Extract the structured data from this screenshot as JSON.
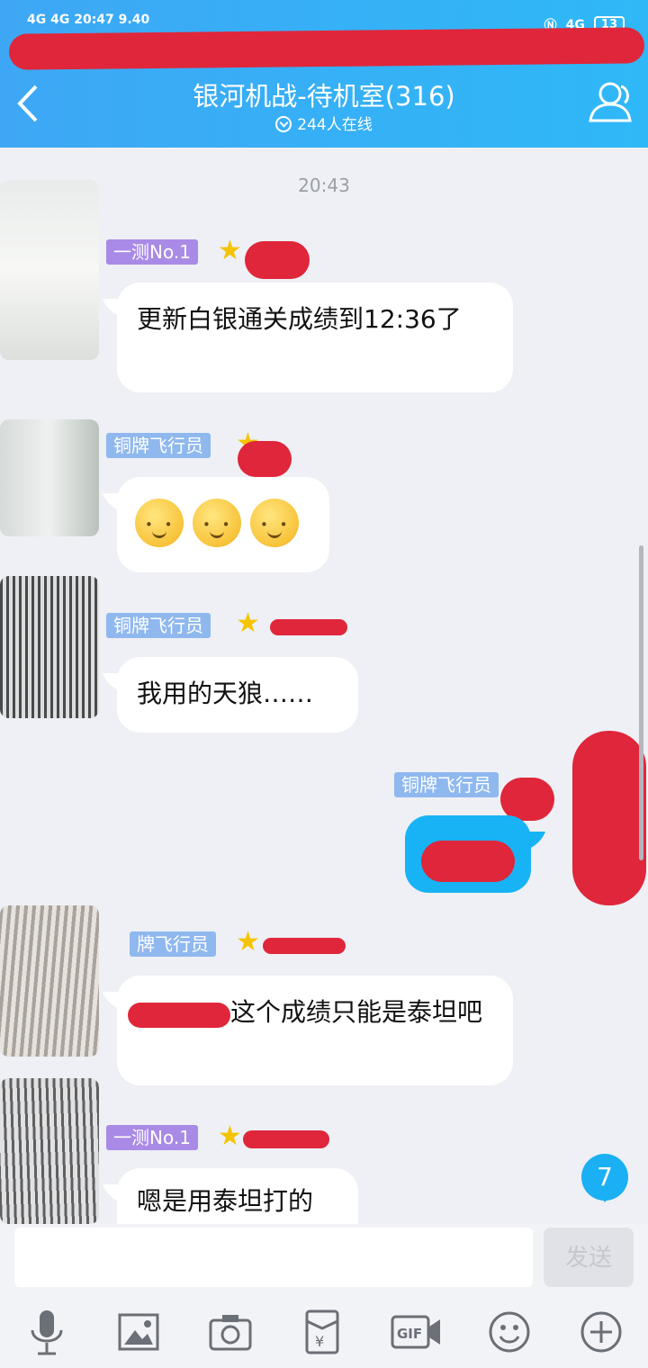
{
  "status_bar": {
    "left": "4G  4G  20:47  9.40",
    "right_signal": "4G",
    "battery": "13"
  },
  "header": {
    "title": "银河机战-待机室(316)",
    "online": "244人在线"
  },
  "chat": {
    "time": "20:43",
    "messages": [
      {
        "tag": "一测No.1",
        "text": "更新白银通关成绩到12:36了"
      },
      {
        "tag": "铜牌飞行员",
        "text": ""
      },
      {
        "tag": "铜牌飞行员",
        "text": "我用的天狼……"
      },
      {
        "tag": "铜牌飞行员",
        "text": ""
      },
      {
        "tag": "牌飞行员",
        "text": "这个成绩只能是泰坦吧"
      },
      {
        "tag": "一测No.1",
        "text": "嗯是用泰坦打的"
      }
    ],
    "unread_count": "7"
  },
  "input_bar": {
    "placeholder": "",
    "send_label": "发送"
  },
  "toolbar": [
    "microphone-icon",
    "image-icon",
    "camera-icon",
    "red-packet-icon",
    "gif-icon",
    "emoji-icon",
    "plus-icon"
  ],
  "colors": {
    "header": "#2fb8f7",
    "accent": "#17b3f4",
    "redaction": "#e0263a"
  }
}
